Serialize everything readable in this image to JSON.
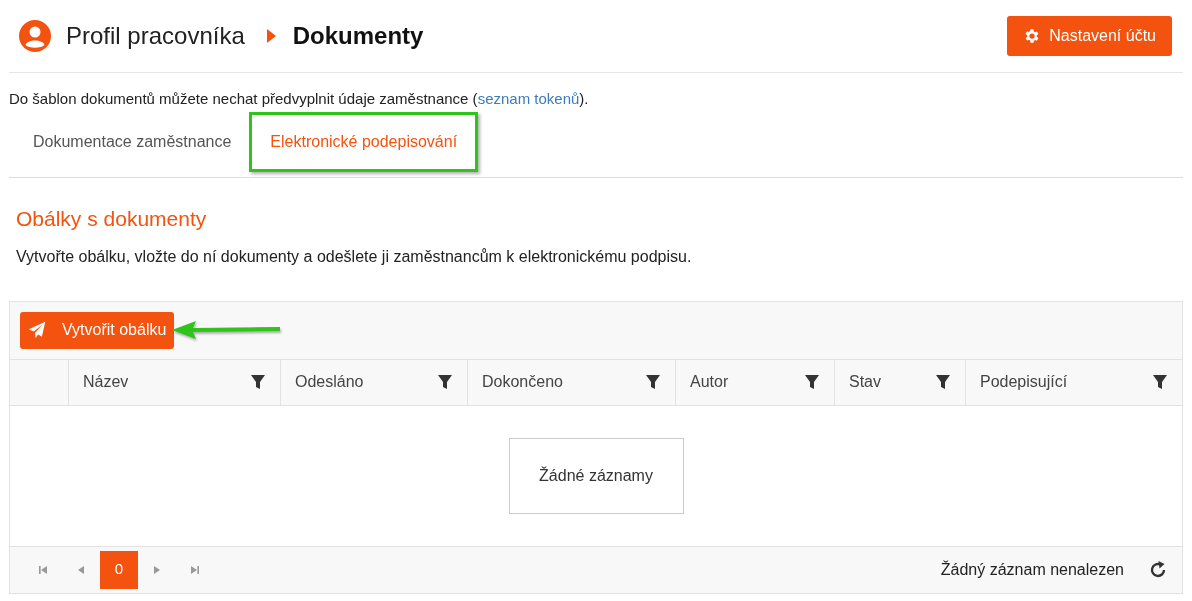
{
  "header": {
    "breadcrumb": [
      "Profil pracovníka",
      "Dokumenty"
    ],
    "settings_button": "Nastavení účtu"
  },
  "info": {
    "text": "Do šablon dokumentů můžete nechat předvyplnit údaje zaměstnance (",
    "link": "seznam tokenů",
    "suffix": ")."
  },
  "tabs": [
    {
      "label": "Dokumentace zaměstnance",
      "selected": false,
      "highlighted": false
    },
    {
      "label": "Elektronické podepisování",
      "selected": true,
      "highlighted": true
    }
  ],
  "section": {
    "title": "Obálky s dokumenty",
    "description": "Vytvořte obálku, vložte do ní dokumenty a odešlete ji zaměstnancům k elektronickému podpisu."
  },
  "grid": {
    "create_button": "Vytvořit obálku",
    "create_button_pointed": true,
    "columns": [
      {
        "label": "Název"
      },
      {
        "label": "Odesláno"
      },
      {
        "label": "Dokončeno"
      },
      {
        "label": "Autor"
      },
      {
        "label": "Stav"
      },
      {
        "label": "Podepisující"
      }
    ],
    "empty_message": "Žádné záznamy",
    "pager": {
      "pages": [
        {
          "label": "0",
          "selected": true
        }
      ],
      "info": "Žádný záznam nenalezen"
    }
  }
}
